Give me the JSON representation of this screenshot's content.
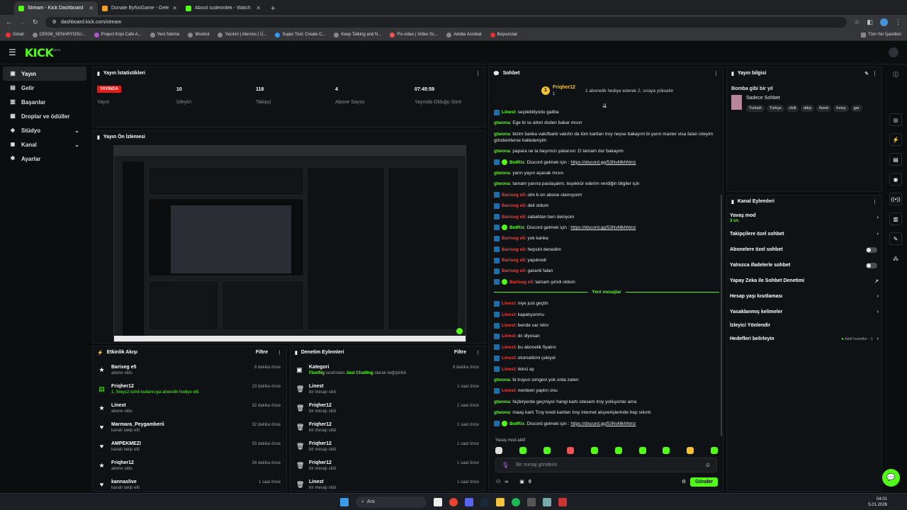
{
  "browser": {
    "tabs": [
      {
        "title": "Stream - Kick Dashboard",
        "color": "#53fc18",
        "active": true
      },
      {
        "title": "Donate ByNoGame - Gelen/Gi",
        "color": "#f0a020",
        "active": false
      },
      {
        "title": "About sudeordek - Watch Live",
        "color": "#53fc18",
        "active": false
      }
    ],
    "new_tab": "+",
    "url": "dashboard.kick.com/stream",
    "bookmarks": [
      "Gmail",
      "CEKIM_SENARYOSU...",
      "Project Kopi Cafe A...",
      "Yeni Sekme",
      "Moobot",
      "Yazılım | Aternos | Ü...",
      "Super Tool: Create C...",
      "Keep Talking and N...",
      "Fix.video | Video Sc...",
      "Adobe Acrobat",
      "Başvurular"
    ],
    "all_bookmarks": "Tüm Yer İşaretleri"
  },
  "header": {
    "logo": "KICK",
    "beta": "BETA"
  },
  "sidebar": {
    "items": [
      {
        "label": "Yayın",
        "icon": "■"
      },
      {
        "label": "Gelir",
        "icon": "▣"
      },
      {
        "label": "Başarılar",
        "icon": "▤"
      },
      {
        "label": "Droplar ve ödüller",
        "icon": "▥"
      },
      {
        "label": "Stüdyo",
        "icon": "◈",
        "chev": "⌄"
      },
      {
        "label": "Kanal",
        "icon": "◼",
        "chev": "⌄"
      },
      {
        "label": "Ayarlar",
        "icon": "✱"
      }
    ]
  },
  "stats": {
    "title": "Yayın İstatistikleri",
    "live_label": "YAYINDA",
    "items": [
      {
        "value": "10",
        "label": "İzleyici"
      },
      {
        "value": "118",
        "label": "Takipçi"
      },
      {
        "value": "4",
        "label": "Abone Sayısı"
      },
      {
        "value": "07:45:59",
        "label": "Yayında Olduğu Süre"
      }
    ],
    "first_label": "Yayın"
  },
  "preview": {
    "title": "Yayın Ön İzlemesi"
  },
  "activity": {
    "title": "Etkinlik Akışı",
    "filter": "Filtre",
    "rows": [
      {
        "icon": "★",
        "name": "Bariseg e5",
        "sub": "abone oldu",
        "time": "8 dakika önce",
        "green": false
      },
      {
        "icon": "▤",
        "name": "Friqher12",
        "sub": "1, Sreys2 isimli kullanıcıya abonelik hediye etti.",
        "time": "23 dakika önce",
        "green": true
      },
      {
        "icon": "★",
        "name": "Linest",
        "sub": "abone oldu",
        "time": "32 dakika önce",
        "green": false
      },
      {
        "icon": "♥",
        "name": "Marmara_Peygamberii",
        "sub": "kanalı takip etti",
        "time": "32 dakika önce",
        "green": false
      },
      {
        "icon": "♥",
        "name": "AMPEKMEZI",
        "sub": "kanalı takip etti",
        "time": "33 dakika önce",
        "green": false
      },
      {
        "icon": "★",
        "name": "Friqher12",
        "sub": "abone oldu",
        "time": "34 dakika önce",
        "green": false
      },
      {
        "icon": "♥",
        "name": "kannaslive",
        "sub": "kanalı takip etti",
        "time": "1 saat önce",
        "green": false
      }
    ]
  },
  "moderation": {
    "title": "Denetim Eylemleri",
    "filter": "Filtre",
    "rows": [
      {
        "name": "Kategori",
        "sub_user": "FluxINg",
        "sub_mid": " tarafından ",
        "sub_cat": "Just Chatting",
        "sub_end": " olarak değiştirildi",
        "time": "8 dakika önce"
      },
      {
        "name": "Linest",
        "sub": "bir mesajı sildi",
        "time": "1 saat önce"
      },
      {
        "name": "Friqher12",
        "sub": "bir mesajı sildi",
        "time": "1 saat önce"
      },
      {
        "name": "Friqher12",
        "sub": "bir mesajı sildi",
        "time": "1 saat önce"
      },
      {
        "name": "Friqher12",
        "sub": "bir mesajı sildi",
        "time": "1 saat önce"
      },
      {
        "name": "Friqher12",
        "sub": "bir mesajı sildi",
        "time": "1 saat önce"
      },
      {
        "name": "Linest",
        "sub": "bir mesajı sildi",
        "time": "1 saat önce"
      }
    ]
  },
  "chat": {
    "title": "Sohbet",
    "pinned_user": "Friqher12",
    "pinned_count": "1",
    "pinned_text": "1 abonelik hediye ederek 2. sıraya yükselin",
    "messages_before": [
      {
        "badge": "mod",
        "user": "Linest",
        "color": "ug",
        "text": ": seçilebiliyodu galiba"
      },
      {
        "badge": "",
        "user": "gtwona",
        "color": "ug",
        "text": ": Ege bi ss attım dcden bakar mısın"
      },
      {
        "badge": "",
        "user": "gtwona",
        "color": "ug",
        "text": ": bizim banka vakıfbank vakıfın da tüm kartları troy neyse bakayım bi yarın master visa falan isteyim gönderirlerse hallederiyim"
      },
      {
        "badge": "",
        "user": "gtwona",
        "color": "ug",
        "text": ": papara ne la başımızı yakarsın :D tamam dur bakayım"
      },
      {
        "badge": "bot",
        "user": "BotRix",
        "color": "ug",
        "text": ": Discord gelmek için : ",
        "link": "https://discord.gg/53NvMkhNmz"
      },
      {
        "badge": "",
        "user": "gtwona",
        "color": "ug",
        "text": ": yarın yayın açacak mısın"
      },
      {
        "badge": "",
        "user": "gtwona",
        "color": "ug",
        "text": ": tamam yarına paslaşalım. teşekkür ederim verdiğin bilgiler için"
      },
      {
        "badge": "mod",
        "user": "Bariseg e5",
        "color": "ur",
        "text": ": olm b en abone olamıyorm"
      },
      {
        "badge": "mod",
        "user": "Bariseg e5",
        "color": "ur",
        "text": ": deli oldum"
      },
      {
        "badge": "mod",
        "user": "Bariseg e5",
        "color": "ur",
        "text": ": sabahtan beri deniyom"
      },
      {
        "badge": "bot",
        "user": "BotRix",
        "color": "ug",
        "text": ": Discord gelmek için : ",
        "link": "https://discord.gg/53NvMkhNmz"
      },
      {
        "badge": "mod",
        "user": "Bariseg e5",
        "color": "ur",
        "text": ": yok kanka"
      },
      {
        "badge": "mod",
        "user": "Bariseg e5",
        "color": "ur",
        "text": ": hepsini denedim"
      },
      {
        "badge": "mod",
        "user": "Bariseg e5",
        "color": "ur",
        "text": ": yapıkredi"
      },
      {
        "badge": "mod",
        "user": "Bariseg e5",
        "color": "ur",
        "text": ": garanti falan"
      },
      {
        "badge": "bot",
        "user": "Bariseg e5",
        "color": "ur",
        "text": ": tamam şimdi oldum"
      }
    ],
    "new_messages": "Yeni mesajlar",
    "messages_after": [
      {
        "badge": "mod",
        "user": "Linest",
        "color": "ur",
        "text": ": niye just geçtin"
      },
      {
        "badge": "mod",
        "user": "Linest",
        "color": "ur",
        "text": ": kapatıyonmu"
      },
      {
        "badge": "mod",
        "user": "Linest",
        "color": "ur",
        "text": ": bende var nitro"
      },
      {
        "badge": "mod",
        "user": "Linest",
        "color": "ur",
        "text": ": dc diyosan"
      },
      {
        "badge": "mod",
        "user": "Linest",
        "color": "ur",
        "text": ": bu abonelik fiyatını"
      },
      {
        "badge": "mod",
        "user": "Linest",
        "color": "ur",
        "text": ": otomatikmi çekiyol"
      },
      {
        "badge": "mod",
        "user": "Linest",
        "color": "ur",
        "text": ": ikinci ay"
      },
      {
        "badge": "",
        "user": "gtwona",
        "color": "ug",
        "text": ": bi troyun simgesi yok orda zaten"
      },
      {
        "badge": "mod",
        "user": "Linest",
        "color": "ur",
        "text": ": nerdeen yaptın onu"
      },
      {
        "badge": "",
        "user": "gtwona",
        "color": "ug",
        "text": ": hiçbiryerde geçmiyor hangi kartı istesem troy yolluyorlar ama"
      },
      {
        "badge": "",
        "user": "gtwona",
        "color": "ug",
        "text": ": maaş kartı Troy kredi kartları troy internet alışverişlerinde hep sıkıntı"
      },
      {
        "badge": "bot",
        "user": "BotRix",
        "color": "ug",
        "text": ": Discord gelmek için : ",
        "link": "https://discord.gg/53NvMkhNmz"
      }
    ],
    "slow_mode": "Yavaş mod aktif",
    "placeholder": "Bir mesaj gönderin",
    "send": "Gönder",
    "count_infinity": "∞",
    "count_zero": "0"
  },
  "info": {
    "title": "Yayın bilgisi",
    "stream_title": "Bomba gibi bir yıl",
    "category": "Sadece Sohbet",
    "tags": [
      "Turkish",
      "Türkçe",
      "chill",
      "ddrp",
      "fivem",
      "funny",
      "gar"
    ]
  },
  "actions": {
    "title": "Kanal Eylemleri",
    "slow": "Yavaş mod",
    "slow_sub": "3 sn.",
    "followers": "Takipçilere özel sohbet",
    "subs": "Abonelere özel sohbet",
    "emotes": "Yalnızca ifadelerle sohbet",
    "ai": "Yapay Zeka ile Sohbet Denetimi",
    "age": "Hesap yaşı kısıtlaması",
    "banned": "Yasaklanmış kelimeler",
    "redirect": "İzleyici Yönlendir",
    "goals": "Hedefleri belirleyin",
    "goals_status": "Aktif hedefler - 1"
  },
  "taskbar": {
    "search": "Ara",
    "time": "04:01",
    "date": "5.01.2026"
  },
  "colors": {
    "accent": "#53fc18",
    "live": "#e91916",
    "bg": "#0b0e0f"
  }
}
